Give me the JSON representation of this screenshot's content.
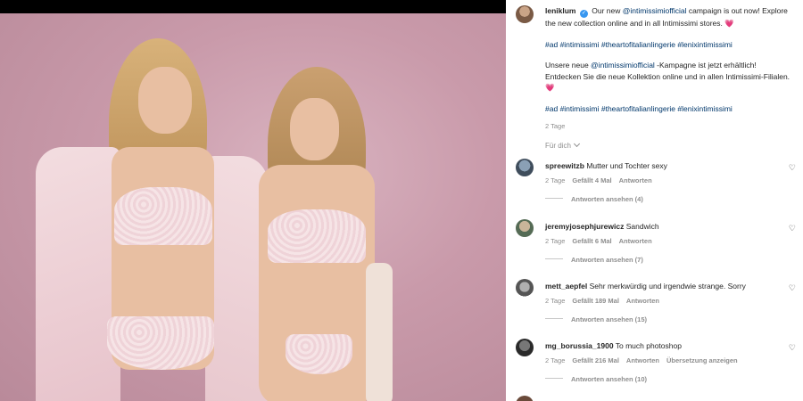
{
  "post": {
    "username": "leniklum",
    "caption_en_prefix": "Our new ",
    "caption_en_mention": "@intimissimiofficial",
    "caption_en_suffix": " campaign is out now! Explore the new collection online and in all Intimissimi stores.",
    "heart": "💗",
    "hashtags_1": [
      "#ad",
      "#intimissimi",
      "#theartofitalianlingerie",
      "#lenixintimissimi"
    ],
    "caption_de_prefix": "Unsere neue ",
    "caption_de_mention": "@intimissimiofficial",
    "caption_de_suffix": " -Kampagne ist jetzt erhältlich! Entdecken Sie die neue Kollektion online und in allen Intimissimi-Filialen.",
    "hashtags_2": [
      "#ad",
      "#intimissimi",
      "#theartofitalianlingerie",
      "#lenixintimissimi"
    ],
    "time": "2 Tage",
    "translate_label": "Für dich"
  },
  "comments": [
    {
      "username": "spreewitzb",
      "text": "Mutter und Tochter sexy",
      "time": "2 Tage",
      "likes": "Gefällt 4 Mal",
      "reply": "Antworten",
      "translate": "",
      "view_replies": "Antworten ansehen (4)",
      "avatar_color": "#5a6a7a"
    },
    {
      "username": "jeremyjosephjurewicz",
      "text": "Sandwich",
      "time": "2 Tage",
      "likes": "Gefällt 6 Mal",
      "reply": "Antworten",
      "translate": "",
      "view_replies": "Antworten ansehen (7)",
      "avatar_color": "#6b7d6a"
    },
    {
      "username": "mett_aepfel",
      "text": "Sehr merkwürdig und irgendwie strange. Sorry",
      "time": "2 Tage",
      "likes": "Gefällt 189 Mal",
      "reply": "Antworten",
      "translate": "",
      "view_replies": "Antworten ansehen (15)",
      "avatar_color": "#8a8a8a"
    },
    {
      "username": "mg_borussia_1900",
      "text": "To much photoshop",
      "time": "2 Tage",
      "likes": "Gefällt 216 Mal",
      "reply": "Antworten",
      "translate": "Übersetzung anzeigen",
      "view_replies": "Antworten ansehen (10)",
      "avatar_color": "#4a4a4a"
    }
  ],
  "icons": {
    "heart": "heart-outline-icon",
    "verified": "verified-badge-icon"
  }
}
